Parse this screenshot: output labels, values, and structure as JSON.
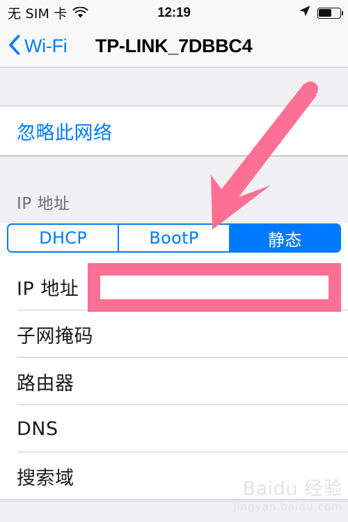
{
  "status_bar": {
    "carrier": "无 SIM 卡",
    "wifi_icon": "wifi-icon",
    "time": "12:19",
    "location_icon": "location-arrow-icon",
    "battery_icon": "battery-icon",
    "battery_percent": 62
  },
  "nav": {
    "back_icon": "chevron-left-icon",
    "back_label": "Wi-Fi",
    "title": "TP-LINK_7DBBC4"
  },
  "actions": {
    "forget_network_label": "忽略此网络"
  },
  "ip_section": {
    "header": "IP 地址",
    "segments": [
      {
        "label": "DHCP",
        "selected": false
      },
      {
        "label": "BootP",
        "selected": false
      },
      {
        "label": "静态",
        "selected": true
      }
    ],
    "fields": [
      {
        "label": "IP 地址",
        "value": "",
        "placeholder": ""
      },
      {
        "label": "子网掩码",
        "value": "",
        "placeholder": ""
      },
      {
        "label": "路由器",
        "value": "",
        "placeholder": ""
      },
      {
        "label": "DNS",
        "value": "",
        "placeholder": ""
      },
      {
        "label": "搜索域",
        "value": "",
        "placeholder": ""
      }
    ]
  },
  "annotations": {
    "arrow_color": "#fb7094",
    "highlight_color": "#fb7094",
    "arrow_icon": "pointer-arrow-annotation",
    "highlight_target": "IP 地址"
  },
  "watermark": {
    "main": "Baidu 经验",
    "sub": "jingyan.baidu.com"
  },
  "theme": {
    "accent": "#007aff",
    "group_background": "#efeff4",
    "separator": "#c8c7cc"
  }
}
